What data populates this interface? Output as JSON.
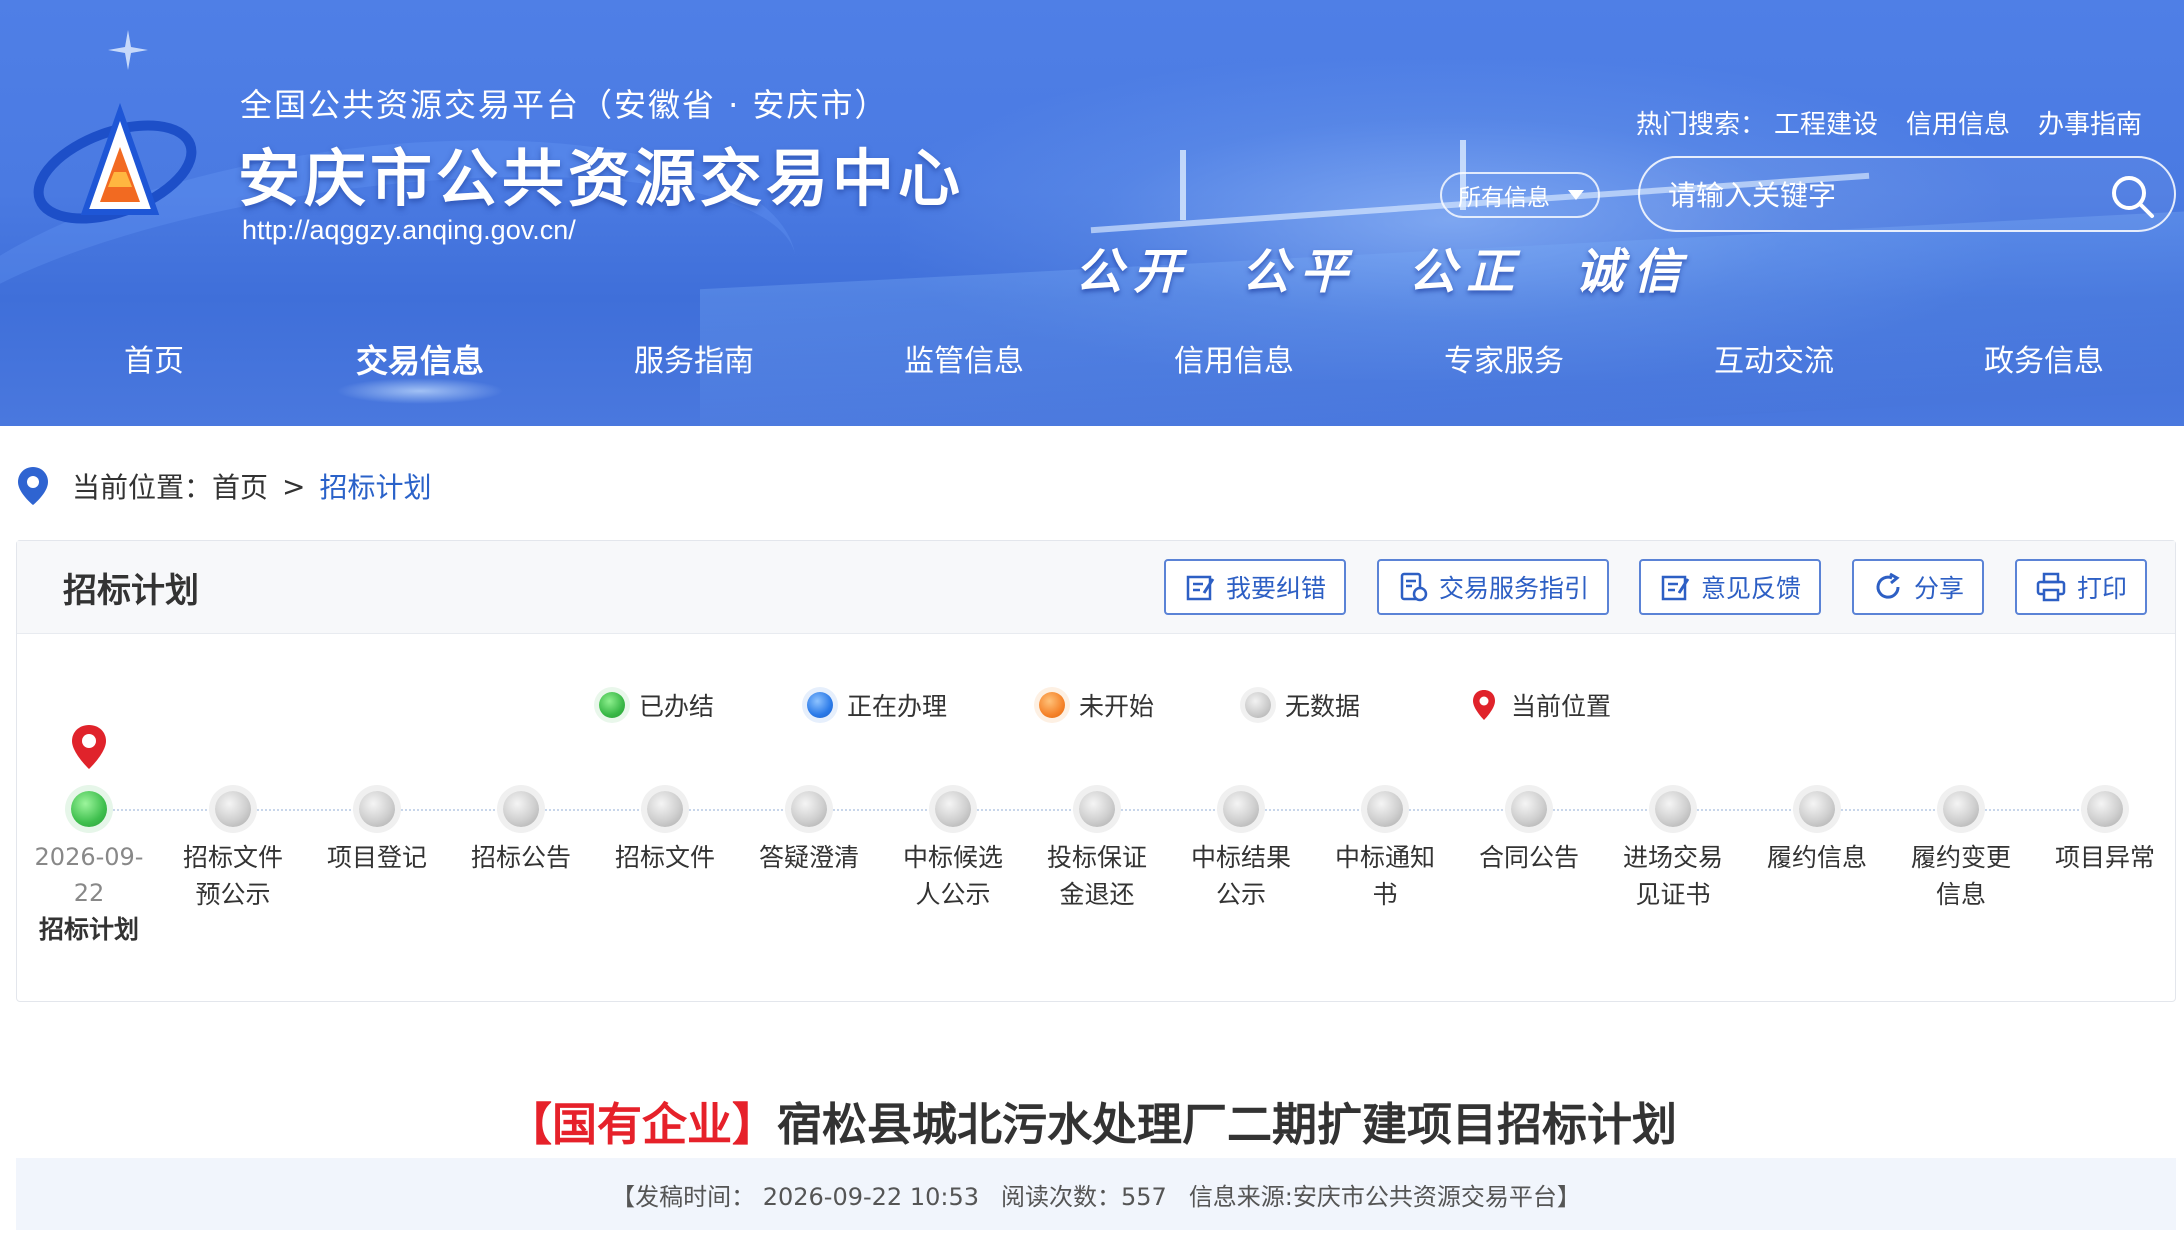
{
  "header": {
    "subtitle": "全国公共资源交易平台（安徽省 · 安庆市）",
    "title": "安庆市公共资源交易中心",
    "url": "http://aqggzy.anqing.gov.cn/",
    "slogan": "公开 公平 公正 诚信",
    "hot_label": "热门搜索：",
    "hot_links": [
      "工程建设",
      "信用信息",
      "办事指南"
    ],
    "search_scope": "所有信息",
    "search_placeholder": "请输入关键字"
  },
  "nav": {
    "items": [
      "首页",
      "交易信息",
      "服务指南",
      "监管信息",
      "信用信息",
      "专家服务",
      "互动交流",
      "政务信息"
    ],
    "active": "交易信息"
  },
  "breadcrumb": {
    "label": "当前位置：",
    "home": "首页",
    "sep": ">",
    "current": "招标计划"
  },
  "panel": {
    "title": "招标计划",
    "buttons": {
      "report_error": "我要纠错",
      "service_guide": "交易服务指引",
      "feedback": "意见反馈",
      "share": "分享",
      "print": "打印"
    },
    "legend": {
      "done": "已办结",
      "doing": "正在办理",
      "todo": "未开始",
      "none": "无数据",
      "current": "当前位置"
    },
    "steps": [
      {
        "label": "招标计划",
        "status": "done",
        "date_line1": "2026-09-",
        "date_line2": "22"
      },
      {
        "label_line1": "招标文件",
        "label_line2": "预公示",
        "status": "none"
      },
      {
        "label_line1": "项目登记",
        "label_line2": "",
        "status": "none"
      },
      {
        "label_line1": "招标公告",
        "label_line2": "",
        "status": "none"
      },
      {
        "label_line1": "招标文件",
        "label_line2": "",
        "status": "none"
      },
      {
        "label_line1": "答疑澄清",
        "label_line2": "",
        "status": "none"
      },
      {
        "label_line1": "中标候选",
        "label_line2": "人公示",
        "status": "none"
      },
      {
        "label_line1": "投标保证",
        "label_line2": "金退还",
        "status": "none"
      },
      {
        "label_line1": "中标结果",
        "label_line2": "公示",
        "status": "none"
      },
      {
        "label_line1": "中标通知",
        "label_line2": "书",
        "status": "none"
      },
      {
        "label_line1": "合同公告",
        "label_line2": "",
        "status": "none"
      },
      {
        "label_line1": "进场交易",
        "label_line2": "见证书",
        "status": "none"
      },
      {
        "label_line1": "履约信息",
        "label_line2": "",
        "status": "none"
      },
      {
        "label_line1": "履约变更",
        "label_line2": "信息",
        "status": "none"
      },
      {
        "label_line1": "项目异常",
        "label_line2": "",
        "status": "none"
      }
    ]
  },
  "article": {
    "tag": "【国有企业】",
    "title": "宿松县城北污水处理厂二期扩建项目招标计划",
    "meta_open": "【发稿时间：",
    "publish_time": "2026-09-22 10:53",
    "reads_label": "阅读次数：",
    "reads": "557",
    "source": "信息来源:安庆市公共资源交易平台】"
  },
  "colors": {
    "header_blue": "#4a7ae2",
    "link_blue": "#2a62c9",
    "tag_red": "#e6212a",
    "done_green": "#3fbf4e",
    "doing_blue": "#2b7ae8",
    "todo_orange": "#f5832a",
    "none_gray": "#c9c9c9"
  }
}
